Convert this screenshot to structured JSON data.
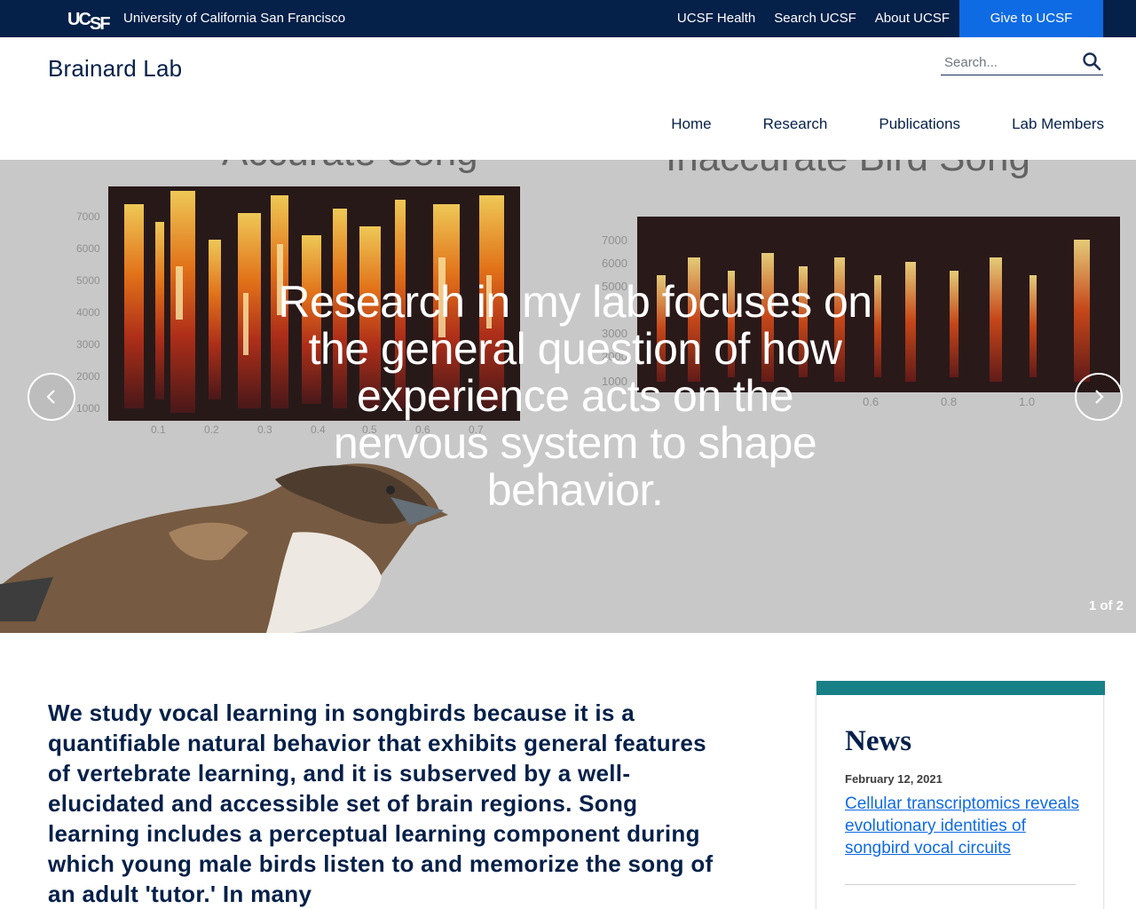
{
  "topbar": {
    "logo_text": "UCSF",
    "university_name": "University of California San Francisco",
    "links": [
      "UCSF Health",
      "Search UCSF",
      "About UCSF"
    ],
    "give_label": "Give to UCSF"
  },
  "header": {
    "site_title": "Brainard Lab",
    "search_placeholder": "Search..."
  },
  "nav": {
    "items": [
      "Home",
      "Research",
      "Publications",
      "Lab Members"
    ]
  },
  "hero": {
    "caption": "Research in my lab focuses on the general question of how experience acts on the nervous system to shape behavior.",
    "slide_counter": "1 of 2"
  },
  "intro": {
    "text": "We study vocal learning in songbirds because it is a quantifiable natural behavior that exhibits general features of vertebrate learning, and it is subserved by a well-elucidated and accessible set of brain regions. Song learning includes a perceptual learning component during which young male birds listen to and memorize the song of an adult 'tutor.' In many"
  },
  "news": {
    "title": "News",
    "items": [
      {
        "date": "February 12, 2021",
        "headline": "Cellular transcriptomics reveals evolutionary identities of songbird vocal circuits"
      }
    ]
  },
  "colors": {
    "navy": "#052049",
    "give_blue": "#0f6be3",
    "teal": "#178187",
    "hero_gray": "#c9c9c9"
  }
}
